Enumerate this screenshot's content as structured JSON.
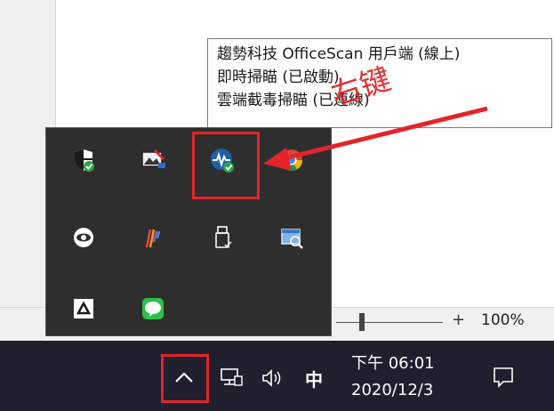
{
  "tooltip": {
    "lines": [
      "趨勢科技 OfficeScan 用戶端 (線上)",
      "即時掃瞄 (已啟動)",
      "雲端截毒掃瞄 (已連線)"
    ]
  },
  "annotation": {
    "text": "右键",
    "color": "#e3242b"
  },
  "status_bar": {
    "zoom_plus": "+",
    "zoom_percent": "100%"
  },
  "tray_icons": [
    {
      "name": "windows-security-shield-icon"
    },
    {
      "name": "display-settings-icon"
    },
    {
      "name": "officescan-icon",
      "highlighted": true
    },
    {
      "name": "chrome-icon"
    },
    {
      "name": "eye-icon"
    },
    {
      "name": "colorful-bars-app-icon"
    },
    {
      "name": "usb-drive-icon"
    },
    {
      "name": "network-scan-icon"
    },
    {
      "name": "google-drive-icon"
    },
    {
      "name": "line-messenger-icon"
    }
  ],
  "taskbar": {
    "ime": "中",
    "time": "下午 06:01",
    "date": "2020/12/3"
  }
}
